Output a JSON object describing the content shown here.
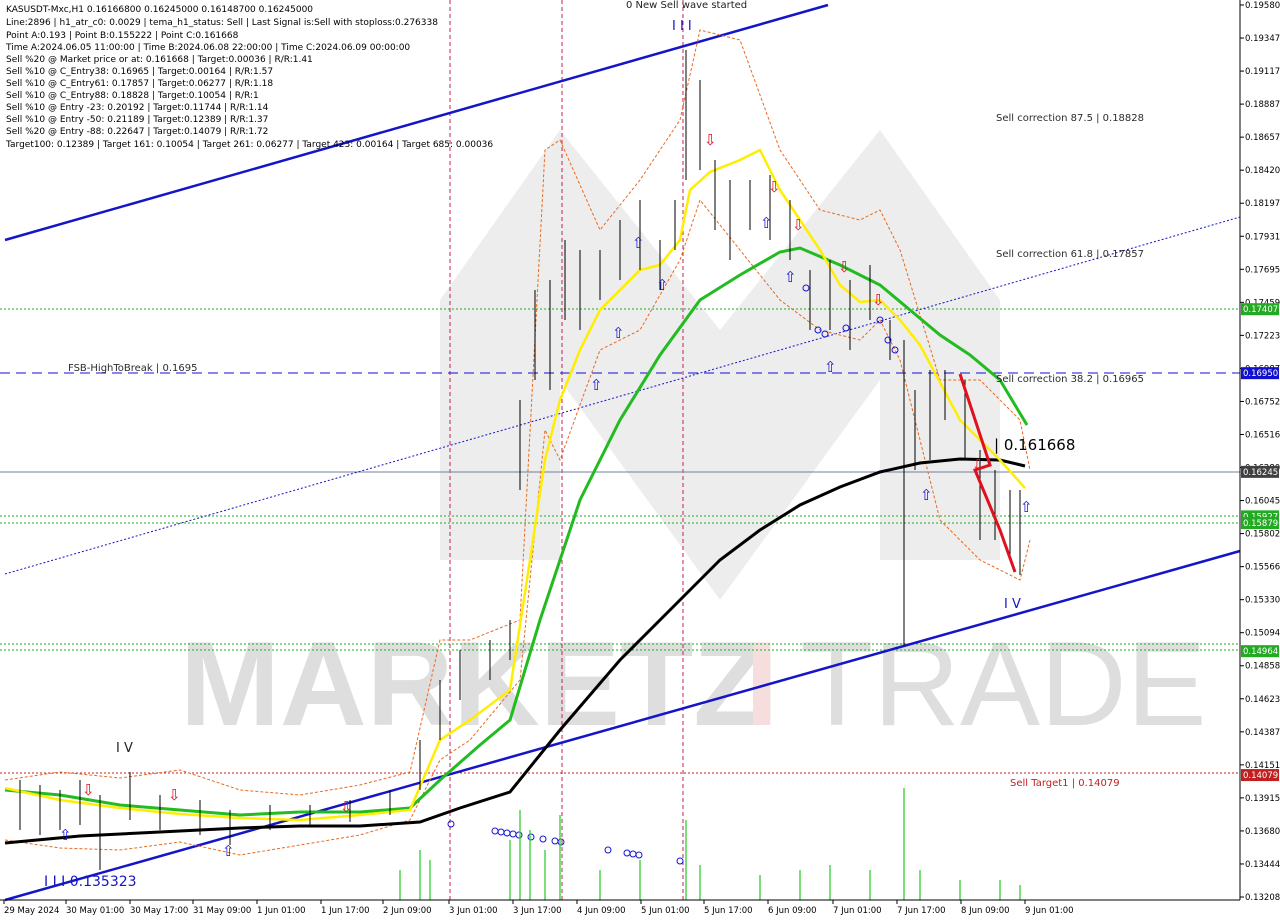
{
  "info_lines": [
    "KASUSDT-Mxc,H1  0.16166800 0.16245000 0.16148700 0.16245000",
    "Line:2896 | h1_atr_c0: 0.0029 | tema_h1_status: Sell | Last Signal is:Sell with stoploss:0.276338",
    "Point A:0.193 | Point B:0.155222 | Point C:0.161668",
    "Time A:2024.06.05 11:00:00 | Time B:2024.06.08 22:00:00 | Time C:2024.06.09 00:00:00",
    "Sell %20 @ Market price or at: 0.161668 | Target:0.00036 | R/R:1.41",
    "Sell %10 @ C_Entry38: 0.16965 | Target:0.00164 | R/R:1.57",
    "Sell %10 @ C_Entry61: 0.17857 | Target:0.06277 | R/R:1.18",
    "Sell %10 @ C_Entry88: 0.18828 | Target:0.10054 | R/R:1",
    "Sell %10 @ Entry -23: 0.20192 | Target:0.11744 | R/R:1.14",
    "Sell %10 @ Entry -50: 0.21189 | Target:0.12389 | R/R:1.37",
    "Sell %20 @ Entry -88: 0.22647 | Target:0.14079 | R/R:1.72",
    "Target100: 0.12389 | Target 161: 0.10054 | Target 261: 0.06277 | Target 423: 0.00164 | Target 685: 0.00036"
  ],
  "top_label": "0 New Sell wave started",
  "wave_labels": {
    "top": "I I I",
    "right": "I V",
    "left": "I V"
  },
  "low_label": "I I I 0.135323",
  "point_c_label": "| 0.161668",
  "levels": [
    {
      "id": "fsb",
      "text": "FSB-HighToBreak | 0.1695",
      "price": 0.1695,
      "color": "#1010d0",
      "style": "dash"
    },
    {
      "id": "sc875",
      "text": "Sell correction 87.5 | 0.18828",
      "price": 0.18828,
      "color": "none",
      "style": "none"
    },
    {
      "id": "sc618",
      "text": "Sell correction 61.8 | 0.17857",
      "price": 0.17857,
      "color": "none",
      "style": "none"
    },
    {
      "id": "sc382",
      "text": "Sell correction 38.2 | 0.16965",
      "price": 0.16965,
      "color": "none",
      "style": "none"
    },
    {
      "id": "st1",
      "text": "Sell Target1 | 0.14079",
      "price": 0.14079,
      "color": "#c02020",
      "style": "dot"
    }
  ],
  "price_tags": [
    {
      "text": "0.17407",
      "price": 0.17407,
      "color": "#22aa22"
    },
    {
      "text": "0.16950",
      "price": 0.1695,
      "color": "#1010d0"
    },
    {
      "text": "0.16245",
      "price": 0.16245,
      "color": "#404040"
    },
    {
      "text": "0.15927",
      "price": 0.15927,
      "color": "#22aa22"
    },
    {
      "text": "0.15879",
      "price": 0.15879,
      "color": "#22aa22"
    },
    {
      "text": "0.14964",
      "price": 0.14964,
      "color": "#22aa22"
    },
    {
      "text": "0.14079",
      "price": 0.14079,
      "color": "#c02020"
    }
  ],
  "watermark": {
    "part1": "MARKETZ",
    "part2": "I",
    "part3": "TRADE"
  },
  "chart_data": {
    "type": "line",
    "symbol": "KASUSDT-Mxc,H1",
    "ylim": [
      0.13208,
      0.1958
    ],
    "y_ticks": [
      "0.19580",
      "0.19347",
      "0.19117",
      "0.18887",
      "0.18657",
      "0.18420",
      "0.18197",
      "0.17931",
      "0.17695",
      "0.17459",
      "0.17223",
      "0.16987",
      "0.16752",
      "0.16516",
      "0.16280",
      "0.16045",
      "0.15802",
      "0.15566",
      "0.15330",
      "0.15094",
      "0.14858",
      "0.14623",
      "0.14387",
      "0.14151",
      "0.13915",
      "0.13680",
      "0.13444",
      "0.13208"
    ],
    "x_ticks": [
      "29 May 2024",
      "30 May 01:00",
      "30 May 17:00",
      "31 May 09:00",
      "1 Jun 01:00",
      "1 Jun 17:00",
      "2 Jun 09:00",
      "3 Jun 01:00",
      "3 Jun 17:00",
      "4 Jun 09:00",
      "5 Jun 01:00",
      "5 Jun 17:00",
      "6 Jun 09:00",
      "7 Jun 01:00",
      "7 Jun 17:00",
      "8 Jun 09:00",
      "9 Jun 01:00"
    ],
    "series": [
      {
        "name": "",
        "color": "#000000",
        "values": [
          0.1363,
          0.1365,
          0.1367,
          0.1369,
          0.137,
          0.1371,
          0.1372,
          0.1373,
          0.1374,
          0.1376,
          0.138,
          0.139,
          0.141,
          0.144,
          0.147,
          0.15,
          0.153,
          0.156,
          0.1585,
          0.1605,
          0.1618,
          0.1625,
          0.1628,
          0.1627,
          0.1624
        ]
      },
      {
        "name": "",
        "color": "#22bb22",
        "values": [
          0.1392,
          0.1382,
          0.1378,
          0.1376,
          0.1378,
          0.138,
          0.139,
          0.142,
          0.147,
          0.153,
          0.16,
          0.166,
          0.172,
          0.177,
          0.178,
          0.177,
          0.175,
          0.1725,
          0.17,
          0.166
        ]
      },
      {
        "name": "",
        "color": "#ffee00",
        "values": [
          0.139,
          0.138,
          0.1378,
          0.1377,
          0.138,
          0.1395,
          0.143,
          0.149,
          0.158,
          0.168,
          0.174,
          0.177,
          0.183,
          0.185,
          0.18,
          0.176,
          0.173,
          0.168,
          0.165,
          0.16
        ]
      }
    ]
  }
}
